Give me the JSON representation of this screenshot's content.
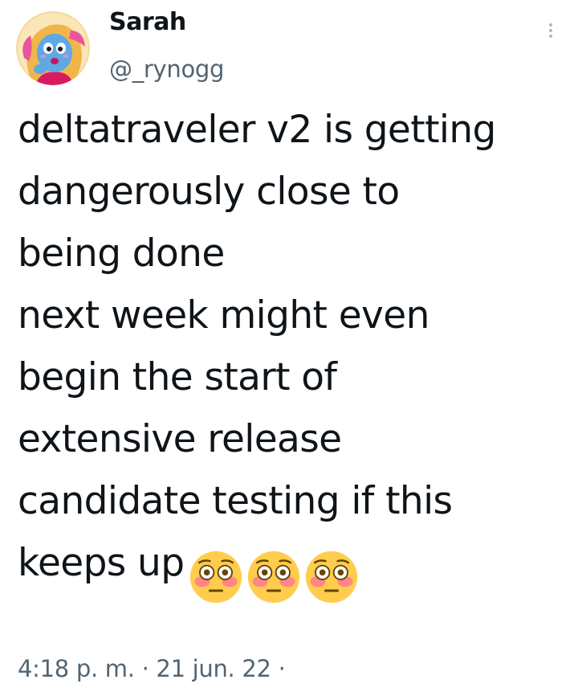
{
  "tweet": {
    "author": {
      "name": "Sarah",
      "handle": "@_rynogg"
    },
    "text_lines": [
      "deltatraveler v2 is getting",
      "dangerously close to",
      "being done",
      "next week might even",
      "begin the start of",
      "extensive release",
      "candidate testing if this",
      "keeps up"
    ],
    "emojis": [
      "flushed-face-icon",
      "flushed-face-icon",
      "flushed-face-icon"
    ],
    "time": "4:18 p. m.",
    "separator": "·",
    "date": "21 jun. 22",
    "trailing_separator": "·"
  },
  "colors": {
    "text": "#0f1419",
    "secondary": "#536471",
    "background": "#ffffff"
  }
}
